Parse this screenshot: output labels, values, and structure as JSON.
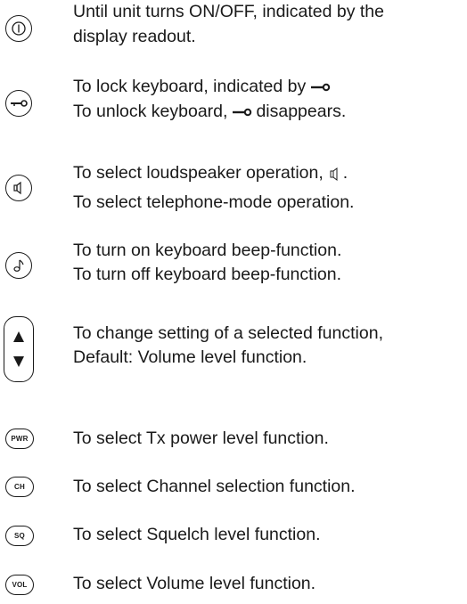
{
  "items": [
    {
      "icon": "power-icon",
      "lines": [
        "Until unit turns ON/OFF, indicated by the",
        "display readout."
      ]
    },
    {
      "icon": "key-icon",
      "line1_before": "To lock keyboard, indicated by",
      "line2_before": "To unlock keyboard,",
      "line2_after": "disappears."
    },
    {
      "icon": "speaker-icon",
      "line1_before": "To select loudspeaker operation,",
      "line1_after": ".",
      "line2": "To select telephone-mode operation."
    },
    {
      "icon": "music-note-icon",
      "lines": [
        "To turn on keyboard beep-function.",
        "To turn off keyboard beep-function."
      ]
    },
    {
      "icon": "up-down-arrows-icon",
      "lines": [
        "To change setting of a selected function,",
        "Default: Volume level function."
      ]
    },
    {
      "button": "PWR",
      "text": "To select Tx power level function."
    },
    {
      "button": "CH",
      "text": "To select Channel selection function."
    },
    {
      "button": "SQ",
      "text": "To select Squelch level function."
    },
    {
      "button": "VOL",
      "text": "To select Volume level function."
    }
  ]
}
